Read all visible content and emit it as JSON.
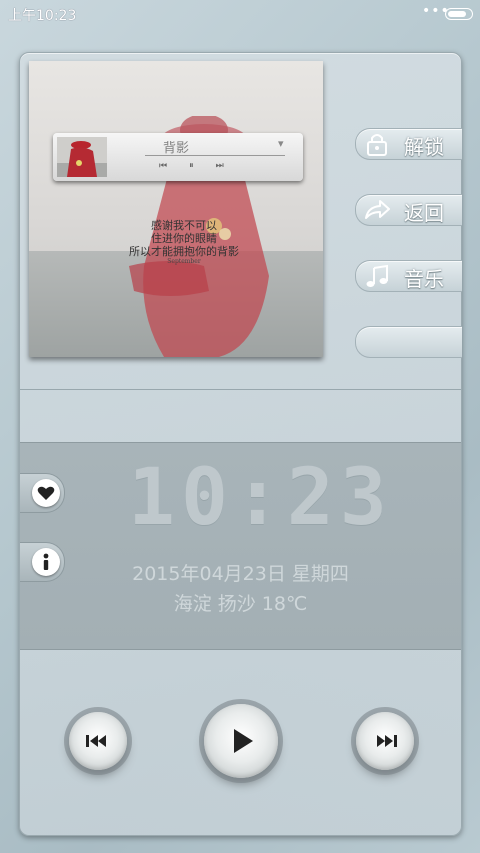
{
  "status_bar": {
    "time": "上午10:23",
    "dots": "•••"
  },
  "album": {
    "track_title": "背影",
    "lyrics": [
      "感谢我不可以",
      "住进你的眼睛",
      "所以才能拥抱你的背影"
    ],
    "lyrics_small": "September"
  },
  "side_buttons": [
    {
      "label": "解锁",
      "icon": "lock-icon"
    },
    {
      "label": "返回",
      "icon": "share-arrow-icon"
    },
    {
      "label": "音乐",
      "icon": "music-note-icon"
    },
    {
      "label": "",
      "icon": ""
    }
  ],
  "clock": {
    "time": "10:23",
    "date": "2015年04月23日 星期四",
    "weather": "海淀  扬沙  18℃"
  },
  "left_icons": [
    "heart-icon",
    "info-icon"
  ],
  "controls": [
    "previous-icon",
    "play-icon",
    "next-icon"
  ],
  "colors": {
    "accent_red": "#b9464b",
    "panel": "#c9d4d9"
  }
}
